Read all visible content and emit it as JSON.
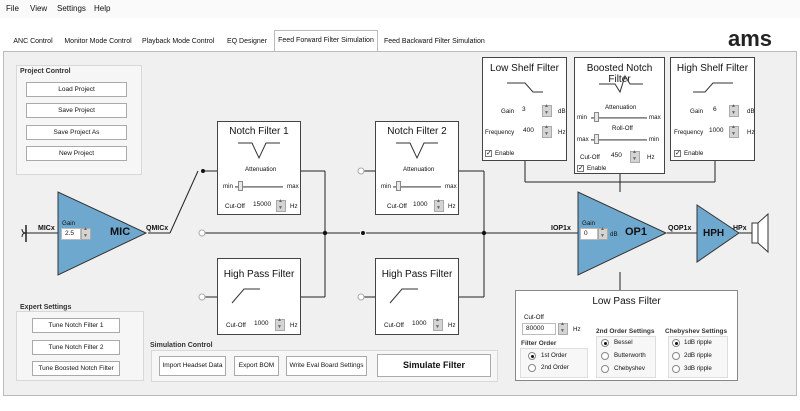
{
  "menu": [
    "File",
    "View",
    "Settings",
    "Help"
  ],
  "tabs": [
    "ANC Control",
    "Monitor Mode Control",
    "Playback Mode Control",
    "EQ Designer",
    "Feed Forward Filter Simulation",
    "Feed Backward Filter Simulation"
  ],
  "active_tab": 4,
  "logo": "ams",
  "project": {
    "title": "Project Control",
    "buttons": [
      "Load Project",
      "Save Project",
      "Save Project As",
      "New Project"
    ]
  },
  "expert": {
    "title": "Expert Settings",
    "buttons": [
      "Tune Notch Filter 1",
      "Tune Notch Filter 2",
      "Tune Boosted Notch Filter"
    ]
  },
  "simulation": {
    "title": "Simulation Control",
    "buttons": [
      "Import Headset Data",
      "Export BOM",
      "Write Eval Board Settings"
    ],
    "simulate_label": "Simulate Filter"
  },
  "mic": {
    "label": "MIC",
    "gain_label": "Gain",
    "gain_value": "2.5",
    "in_label": "MICx",
    "out_label": "QMICx"
  },
  "op1": {
    "label": "OP1",
    "gain_label": "Gain",
    "gain_value": "0",
    "gain_unit": "dB",
    "in_label": "IOP1x",
    "out_label": "QOP1x"
  },
  "hph": {
    "label": "HPH",
    "out_label": "HPx"
  },
  "notch1": {
    "title": "Notch Filter 1",
    "atten": "Attenuation",
    "min": "min",
    "max": "max",
    "cutoff_label": "Cut-Off",
    "cutoff": "15000",
    "unit": "Hz"
  },
  "notch2": {
    "title": "Notch Filter 2",
    "atten": "Attenuation",
    "min": "min",
    "max": "max",
    "cutoff_label": "Cut-Off",
    "cutoff": "1000",
    "unit": "Hz"
  },
  "hp1": {
    "title": "High Pass Filter",
    "cutoff_label": "Cut-Off",
    "cutoff": "1000",
    "unit": "Hz"
  },
  "hp2": {
    "title": "High Pass Filter",
    "cutoff_label": "Cut-Off",
    "cutoff": "1000",
    "unit": "Hz"
  },
  "lowshelf": {
    "title": "Low Shelf Filter",
    "gain_label": "Gain",
    "gain": "3",
    "gain_unit": "dB",
    "freq_label": "Frequency",
    "freq": "400",
    "freq_unit": "Hz",
    "enable": "Enable",
    "enabled": true
  },
  "boosted": {
    "title": "Boosted Notch Filter",
    "atten": "Attenuation",
    "min": "min",
    "max": "max",
    "rolloff": "Roll-Off",
    "cutoff_label": "Cut-Off",
    "cutoff": "450",
    "unit": "Hz",
    "enable": "Enable",
    "enabled": true
  },
  "highshelf": {
    "title": "High Shelf Filter",
    "gain_label": "Gain",
    "gain": "6",
    "gain_unit": "dB",
    "freq_label": "Frequency",
    "freq": "1000",
    "freq_unit": "Hz",
    "enable": "Enable",
    "enabled": true
  },
  "lowpass": {
    "title": "Low Pass Filter",
    "cutoff_label": "Cut-Off",
    "cutoff": "80000",
    "unit": "Hz",
    "order_title": "Filter Order",
    "orders": [
      "1st Order",
      "2nd Order"
    ],
    "order_selected": 0,
    "second_title": "2nd Order Settings",
    "seconds": [
      "Bessel",
      "Butterworth",
      "Chebyshev"
    ],
    "second_selected": 0,
    "cheb_title": "Chebyshev Settings",
    "chebs": [
      "1dB ripple",
      "2dB ripple",
      "3dB ripple"
    ],
    "cheb_selected": 0
  },
  "colors": {
    "amp_fill": "#6fa8cf",
    "amp_stroke": "#333333",
    "window_bg": "#f0f0f0"
  }
}
